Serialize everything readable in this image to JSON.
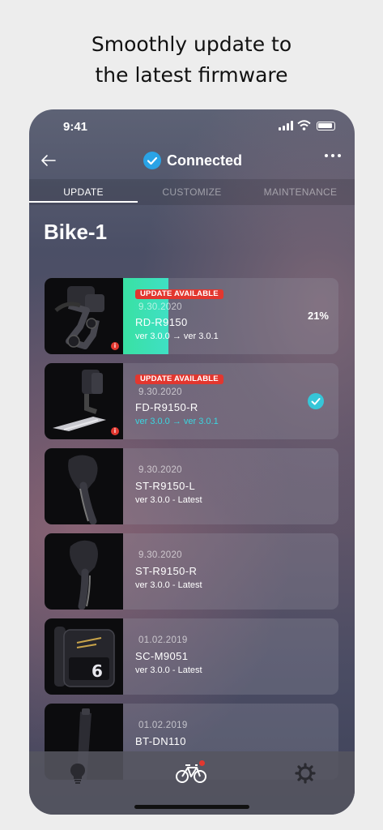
{
  "headline": {
    "line1": "Smoothly update to",
    "line2": "the latest firmware"
  },
  "status_bar": {
    "time": "9:41"
  },
  "nav": {
    "back_icon": "back-arrow-icon",
    "status_label": "Connected",
    "status_icon": "check-circle-icon",
    "more_icon": "more-icon"
  },
  "tabs": [
    {
      "label": "UPDATE",
      "active": true
    },
    {
      "label": "CUSTOMIZE",
      "active": false
    },
    {
      "label": "MAINTENANCE",
      "active": false
    }
  ],
  "page_title": "Bike-1",
  "devices": [
    {
      "badge": "UPDATE AVAILABLE",
      "date": "9.30.2020",
      "model": "RD-R9150",
      "version": "ver 3.0.0 → ver 3.0.1",
      "status": "updating",
      "progress_label": "21%",
      "progress": 0.21
    },
    {
      "badge": "UPDATE AVAILABLE",
      "date": "9.30.2020",
      "model": "FD-R9150-R",
      "version": "ver 3.0.0 → ver 3.0.1",
      "status": "done"
    },
    {
      "date": "9.30.2020",
      "model": "ST-R9150-L",
      "version": "ver 3.0.0 - Latest"
    },
    {
      "date": "9.30.2020",
      "model": "ST-R9150-R",
      "version": "ver 3.0.0 - Latest"
    },
    {
      "date": "01.02.2019",
      "model": "SC-M9051",
      "version": "ver 3.0.0 - Latest"
    },
    {
      "date": "01.02.2019",
      "model": "BT-DN110",
      "version": ""
    }
  ],
  "tab_bar": {
    "items": [
      {
        "icon": "lightbulb-icon"
      },
      {
        "icon": "bicycle-icon",
        "active": true,
        "notification": true
      },
      {
        "icon": "gear-icon"
      }
    ]
  },
  "colors": {
    "accent": "#2aa3e6",
    "badge": "#e2372f",
    "progress": "#39e1a3",
    "success": "#36c6d8"
  }
}
